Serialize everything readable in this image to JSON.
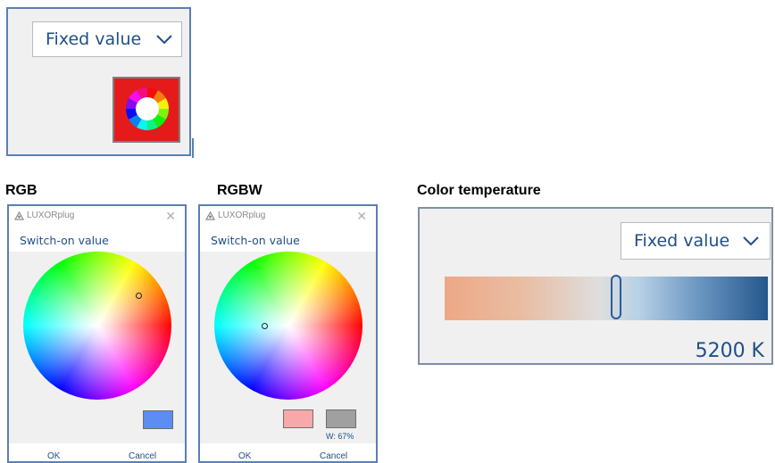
{
  "top_panel": {
    "dropdown_value": "Fixed value",
    "swatch_color": "#e51b1b"
  },
  "headings": {
    "rgb": "RGB",
    "rgbw": "RGBW",
    "color_temperature": "Color temperature"
  },
  "rgb_dialog": {
    "app_title": "LUXORplug",
    "subtitle": "Switch-on value",
    "selected_color": "#5b8df2",
    "ok_label": "OK",
    "cancel_label": "Cancel"
  },
  "rgbw_dialog": {
    "app_title": "LUXORplug",
    "subtitle": "Switch-on value",
    "selected_color": "#f7a8a8",
    "white_color": "#a0a0a0",
    "white_label": "W: 67%",
    "white_level": 0.67,
    "ok_label": "OK",
    "cancel_label": "Cancel"
  },
  "color_temp_panel": {
    "dropdown_value": "Fixed value",
    "value_label": "5200 K"
  },
  "icons": {
    "close": "close-icon",
    "chevron": "chevron-down-icon",
    "app": "luxorplug-logo-icon",
    "wheel": "color-wheel-icon"
  }
}
